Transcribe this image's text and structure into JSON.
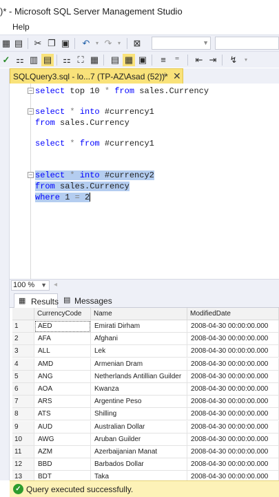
{
  "window": {
    "title": ")* - Microsoft SQL Server Management Studio"
  },
  "menu": {
    "items": [
      "Help"
    ]
  },
  "document_tab": {
    "title": "SQLQuery3.sql - lo...7 (TP-AZ\\Asad (52))*",
    "pin_icon": "pin-icon",
    "close_icon": "close-icon"
  },
  "editor": {
    "lines": [
      {
        "kw1": "select",
        "t1": " top 10 ",
        "g1": "*",
        "kw2": " from",
        "t2": " sales.Currency"
      },
      {
        "kw1": "select",
        "g1": " * ",
        "kw2": "into",
        "t2": " #currency1"
      },
      {
        "kw1": "from",
        "t2": " sales.Currency"
      },
      {
        "kw1": "select",
        "g1": " * ",
        "kw2": "from",
        "t2": " #currency1"
      },
      {
        "kw1": "select",
        "g1": " * ",
        "kw2": "into",
        "t2": " #currency2"
      },
      {
        "kw1": "from",
        "t2": " sales.Currency"
      },
      {
        "kw1": "where",
        "t1": " 1 ",
        "g1": "=",
        "t2": " 2"
      }
    ]
  },
  "zoom": {
    "value": "100 %"
  },
  "results": {
    "tabs": [
      "Results",
      "Messages"
    ],
    "columns": [
      "",
      "CurrencyCode",
      "Name",
      "ModifiedDate"
    ],
    "rows": [
      [
        "1",
        "AED",
        "Emirati Dirham",
        "2008-04-30 00:00:00.000"
      ],
      [
        "2",
        "AFA",
        "Afghani",
        "2008-04-30 00:00:00.000"
      ],
      [
        "3",
        "ALL",
        "Lek",
        "2008-04-30 00:00:00.000"
      ],
      [
        "4",
        "AMD",
        "Armenian Dram",
        "2008-04-30 00:00:00.000"
      ],
      [
        "5",
        "ANG",
        "Netherlands Antillian Guilder",
        "2008-04-30 00:00:00.000"
      ],
      [
        "6",
        "AOA",
        "Kwanza",
        "2008-04-30 00:00:00.000"
      ],
      [
        "7",
        "ARS",
        "Argentine Peso",
        "2008-04-30 00:00:00.000"
      ],
      [
        "8",
        "ATS",
        "Shilling",
        "2008-04-30 00:00:00.000"
      ],
      [
        "9",
        "AUD",
        "Australian Dollar",
        "2008-04-30 00:00:00.000"
      ],
      [
        "10",
        "AWG",
        "Aruban Guilder",
        "2008-04-30 00:00:00.000"
      ],
      [
        "11",
        "AZM",
        "Azerbaijanian Manat",
        "2008-04-30 00:00:00.000"
      ],
      [
        "12",
        "BBD",
        "Barbados Dollar",
        "2008-04-30 00:00:00.000"
      ],
      [
        "13",
        "BDT",
        "Taka",
        "2008-04-30 00:00:00.000"
      ]
    ]
  },
  "status": {
    "message": "Query executed successfully."
  }
}
